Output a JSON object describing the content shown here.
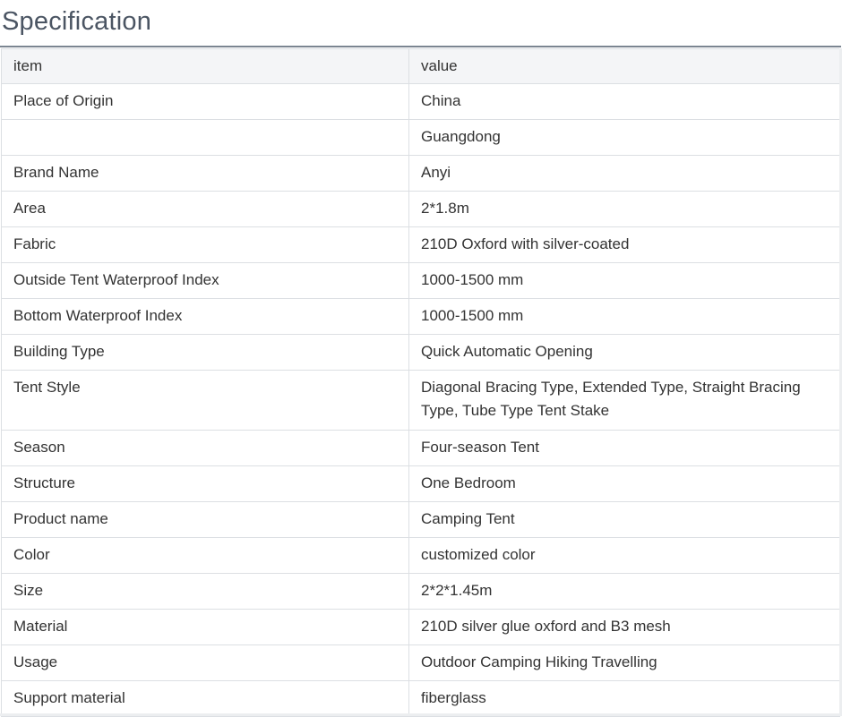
{
  "section": {
    "title": "Specification"
  },
  "table": {
    "headers": {
      "item": "item",
      "value": "value"
    },
    "rows": [
      {
        "item": "Place of Origin",
        "value": "China"
      },
      {
        "item": "",
        "value": "Guangdong"
      },
      {
        "item": "Brand Name",
        "value": "Anyi"
      },
      {
        "item": "Area",
        "value": "2*1.8m"
      },
      {
        "item": "Fabric",
        "value": "210D Oxford with silver-coated"
      },
      {
        "item": "Outside Tent Waterproof Index",
        "value": "1000-1500 mm"
      },
      {
        "item": "Bottom Waterproof Index",
        "value": "1000-1500 mm"
      },
      {
        "item": "Building Type",
        "value": "Quick Automatic Opening"
      },
      {
        "item": "Tent Style",
        "value": "Diagonal Bracing Type, Extended Type, Straight Bracing Type, Tube Type Tent Stake"
      },
      {
        "item": "Season",
        "value": "Four-season Tent"
      },
      {
        "item": "Structure",
        "value": "One Bedroom"
      },
      {
        "item": "Product name",
        "value": "Camping Tent"
      },
      {
        "item": "Color",
        "value": "customized color"
      },
      {
        "item": "Size",
        "value": "2*2*1.45m"
      },
      {
        "item": "Material",
        "value": "210D silver glue oxford and B3 mesh"
      },
      {
        "item": "Usage",
        "value": "Outdoor Camping Hiking Travelling"
      },
      {
        "item": "Support material",
        "value": "fiberglass"
      }
    ]
  },
  "colors": {
    "heading_text": "#4b5563",
    "heading_rule": "#7b8591",
    "header_row_background": "#f4f5f7",
    "cell_border": "#dcdfe3",
    "body_text": "#333333"
  }
}
